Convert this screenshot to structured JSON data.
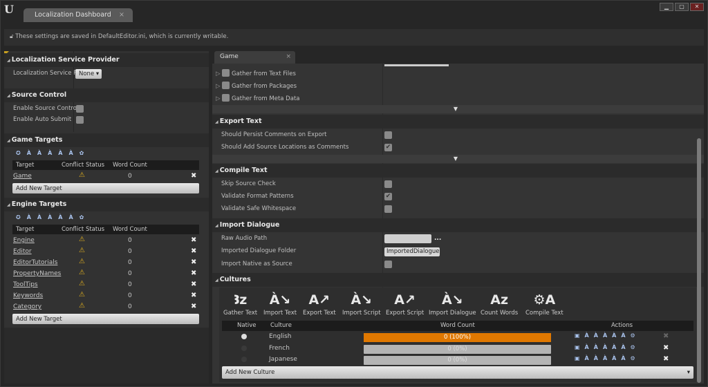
{
  "window": {
    "tab": "Localization Dashboard",
    "close": "×",
    "min": "▁",
    "max": "▢",
    "win_close": "✕"
  },
  "info": "These settings are saved in DefaultEditor.ini, which is currently writable.",
  "left": {
    "lsp": {
      "title": "Localization Service Provider",
      "label": "Localization Service P",
      "value": "None ▾"
    },
    "sc": {
      "title": "Source Control",
      "enable": "Enable Source Control",
      "auto": "Enable Auto Submit"
    },
    "headers": {
      "target": "Target",
      "conflict": "Conflict Status",
      "words": "Word Count"
    },
    "game": {
      "title": "Game Targets",
      "rows": [
        {
          "name": "Game",
          "count": "0"
        }
      ],
      "add": "Add New Target"
    },
    "engine": {
      "title": "Engine Targets",
      "rows": [
        {
          "name": "Engine",
          "count": "0"
        },
        {
          "name": "Editor",
          "count": "0"
        },
        {
          "name": "EditorTutorials",
          "count": "0"
        },
        {
          "name": "PropertyNames",
          "count": "0"
        },
        {
          "name": "ToolTips",
          "count": "0"
        },
        {
          "name": "Keywords",
          "count": "0"
        },
        {
          "name": "Category",
          "count": "0"
        }
      ],
      "add": "Add New Target"
    }
  },
  "right": {
    "tab": "Game",
    "gather": [
      "Gather from Text Files",
      "Gather from Packages",
      "Gather from Meta Data"
    ],
    "export": {
      "title": "Export Text",
      "persist": "Should Persist Comments on Export",
      "add_src": "Should Add Source Locations as Comments"
    },
    "compile": {
      "title": "Compile Text",
      "skip": "Skip Source Check",
      "validate_fmt": "Validate Format Patterns",
      "validate_ws": "Validate Safe Whitespace"
    },
    "import": {
      "title": "Import Dialogue",
      "raw": "Raw Audio Path",
      "raw_value": "",
      "browse": "...",
      "folder": "Imported Dialogue Folder",
      "folder_value": "ImportedDialogue",
      "native": "Import Native as Source"
    },
    "cultures": {
      "title": "Cultures",
      "toolbar": [
        "Gather Text",
        "Import Text",
        "Export Text",
        "Import Script",
        "Export Script",
        "Import Dialogue",
        "Count Words",
        "Compile Text"
      ],
      "headers": {
        "native": "Native",
        "culture": "Culture",
        "words": "Word Count",
        "actions": "Actions"
      },
      "rows": [
        {
          "name": "English",
          "count": "0 (100%)",
          "percent": 100,
          "native": true
        },
        {
          "name": "French",
          "count": "0 (0%)",
          "percent": 0,
          "native": false
        },
        {
          "name": "Japanese",
          "count": "0 (0%)",
          "percent": 0,
          "native": false
        }
      ],
      "add": "Add New Culture"
    },
    "accent": "#e07800"
  }
}
